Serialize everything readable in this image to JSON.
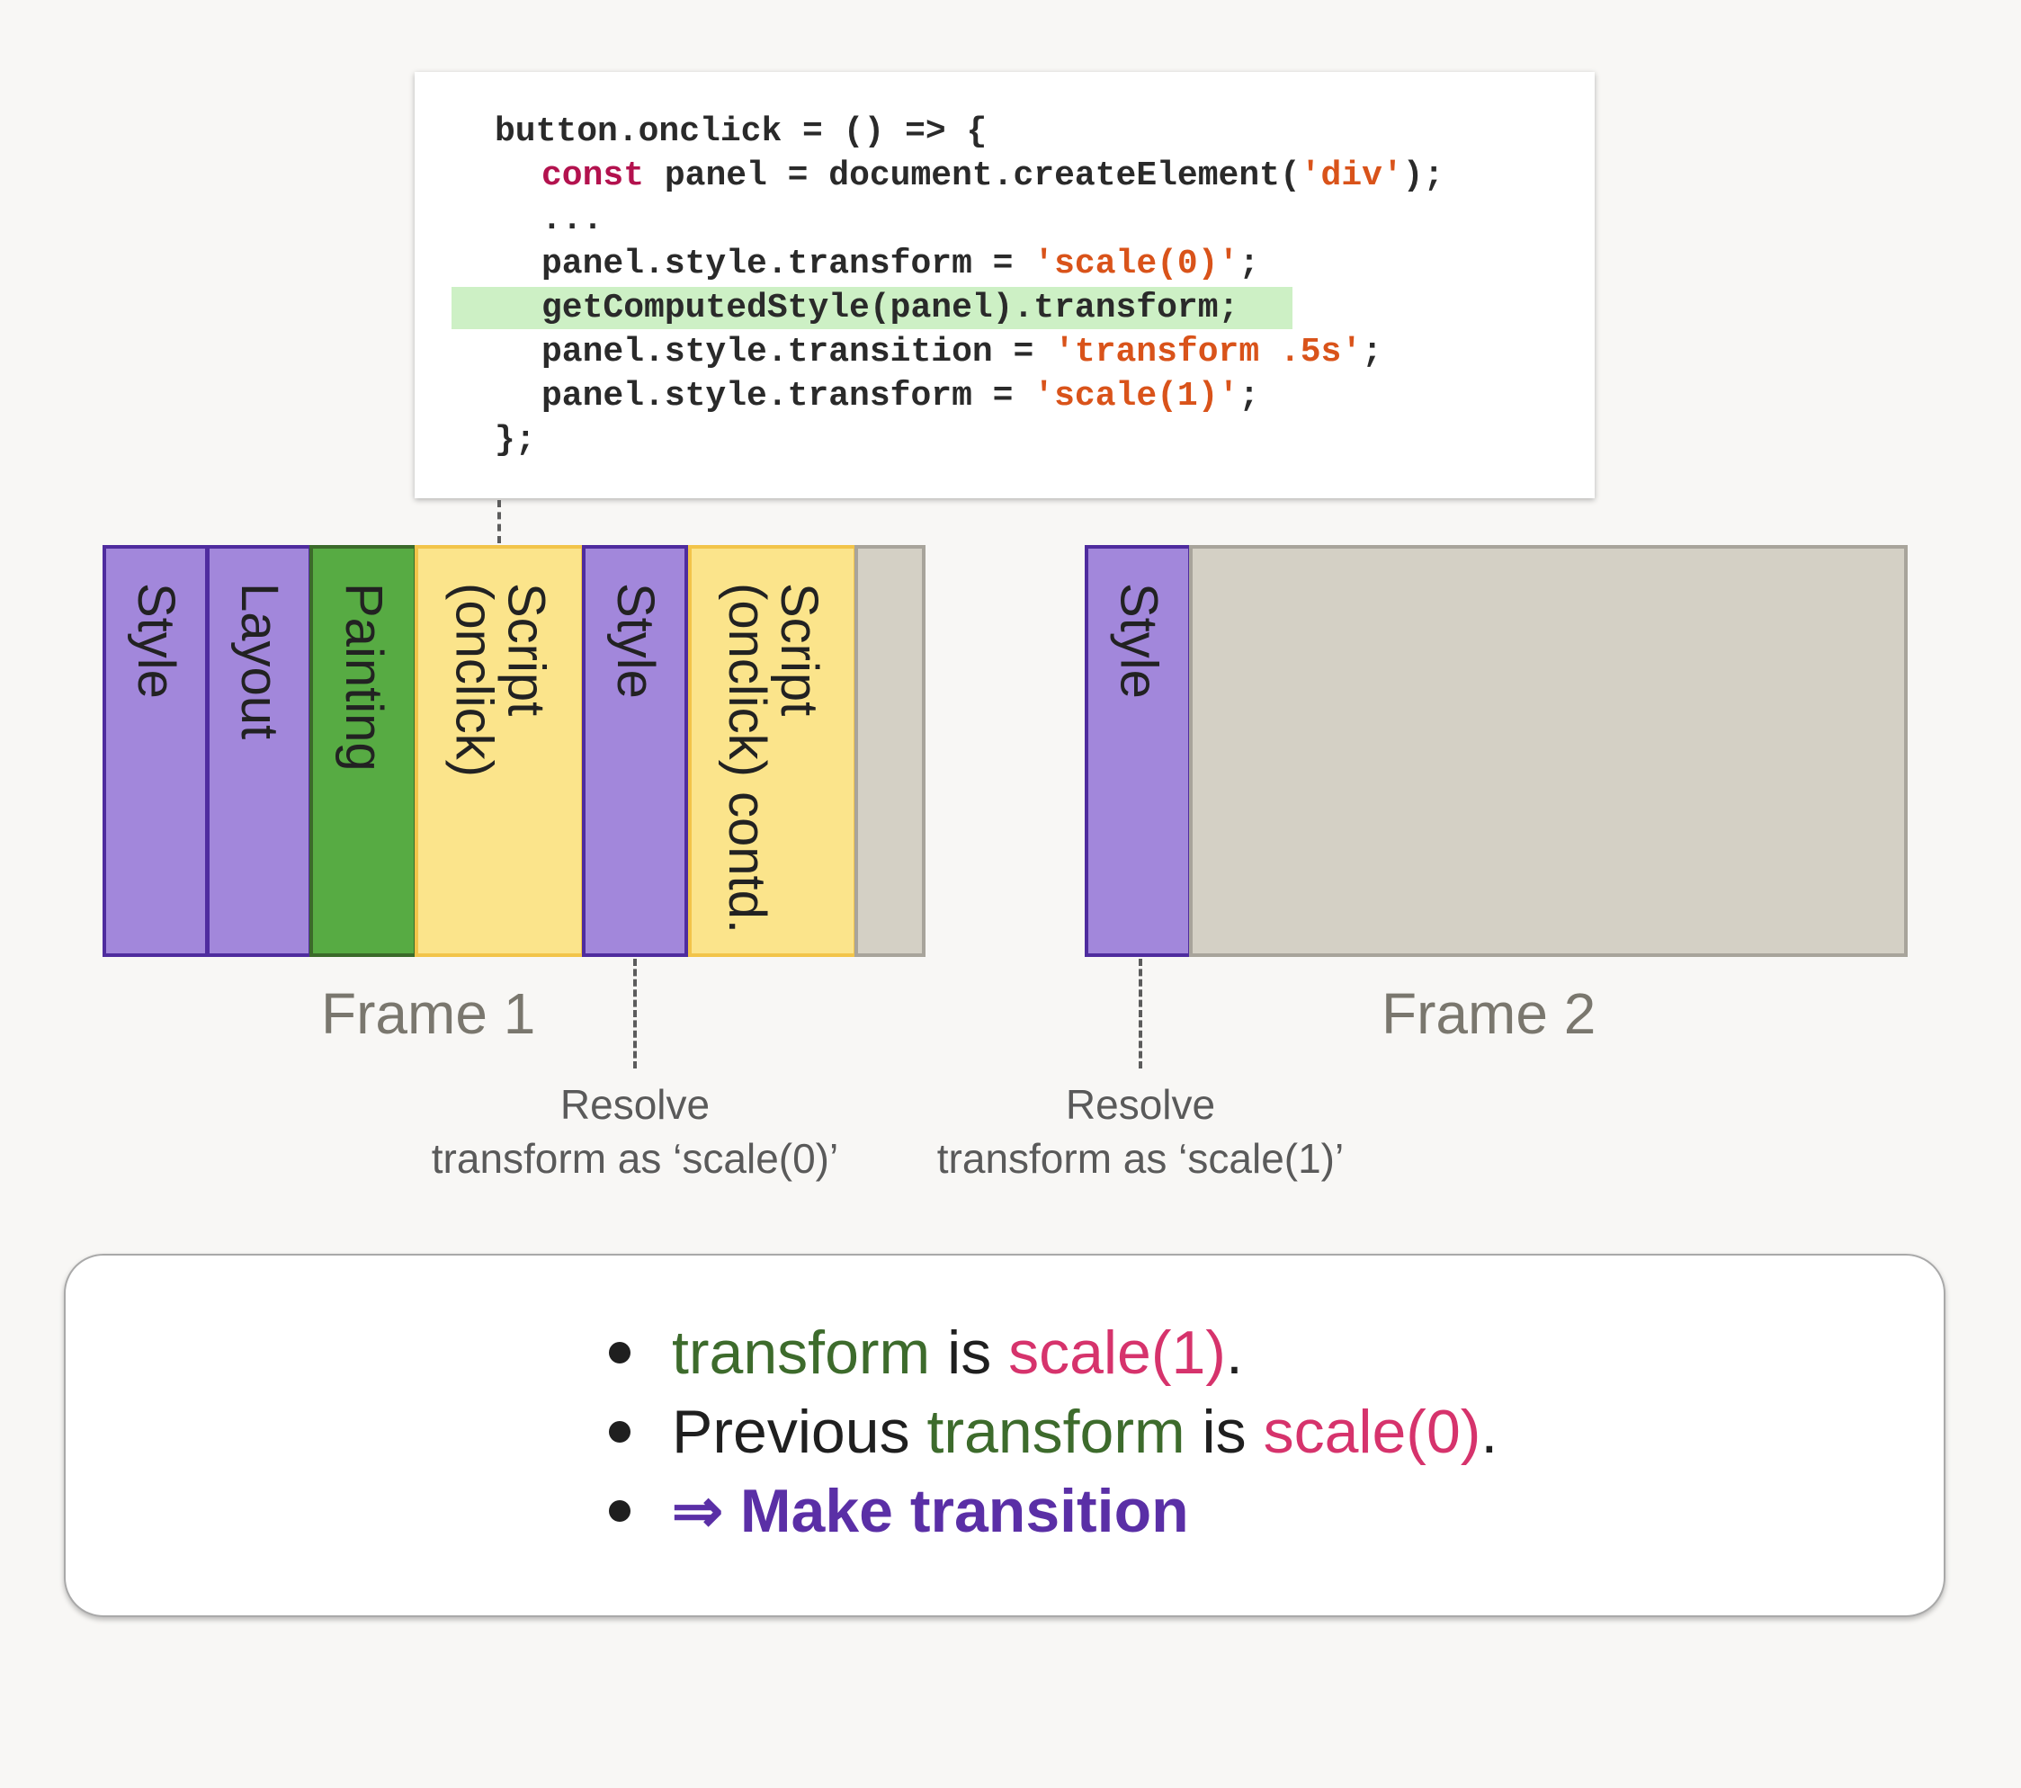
{
  "code": {
    "lines": [
      {
        "plain": "button.onclick = () => {"
      },
      {
        "kw": "const",
        "mid": " panel = document.createElement(",
        "str": "'div'",
        "end": ");"
      },
      {
        "plain": "..."
      },
      {
        "pre": "panel.style.transform = ",
        "str": "'scale(0)'",
        "end": ";"
      },
      {
        "plain": "getComputedStyle(panel).transform;"
      },
      {
        "pre": "panel.style.transition = ",
        "str": "'transform .5s'",
        "end": ";"
      },
      {
        "pre": "panel.style.transform = ",
        "str": "'scale(1)'",
        "end": ";"
      },
      {
        "plain": "};"
      }
    ]
  },
  "frame1": {
    "label": "Frame 1",
    "blocks": [
      "Style",
      "Layout",
      "Painting",
      "Script\n(onclick)",
      "Style",
      "Script\n(onclick) contd."
    ]
  },
  "frame2": {
    "label": "Frame 2",
    "blocks": [
      "Style"
    ]
  },
  "captions": {
    "resolve1": "Resolve\ntransform as ‘scale(0)’",
    "resolve2": "Resolve\ntransform as ‘scale(1)’"
  },
  "notes": {
    "b1": {
      "a": "transform",
      "b": " is ",
      "c": "scale(1)",
      "d": "."
    },
    "b2": {
      "a": "Previous ",
      "b": "transform",
      "c": " is ",
      "d": "scale(0)",
      "e": "."
    },
    "b3": {
      "a": "⇒ Make transition"
    }
  },
  "colors": {
    "style": "#a287db",
    "painting": "#57ab43",
    "script": "#fbe48b",
    "idle": "#d4d0c5",
    "highlight": "#cdf0c5"
  }
}
